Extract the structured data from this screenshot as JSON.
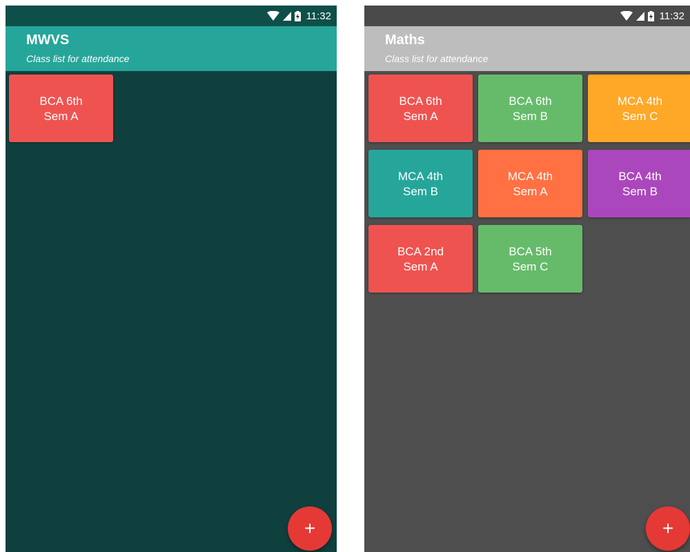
{
  "status": {
    "time": "11:32"
  },
  "screens": [
    {
      "id": "left",
      "title": "MWVS",
      "subtitle": "Class list for attendance",
      "colors": {
        "status_bar": "#0e4f49",
        "app_bar": "#26a69a",
        "background": "#0f403e"
      },
      "classes": [
        {
          "line1": "BCA 6th",
          "line2": "Sem A",
          "color": "#ef5350"
        }
      ],
      "fab": {
        "icon": "plus-icon",
        "label": "+",
        "color": "#e53935"
      }
    },
    {
      "id": "right",
      "title": "Maths",
      "subtitle": "Class list for attendance",
      "colors": {
        "status_bar": "#4a4a4a",
        "app_bar": "#bdbdbd",
        "background": "#4e4e4e"
      },
      "classes": [
        {
          "line1": "BCA 6th",
          "line2": "Sem A",
          "color": "#ef5350"
        },
        {
          "line1": "BCA 6th",
          "line2": "Sem B",
          "color": "#66bb6a"
        },
        {
          "line1": "MCA 4th",
          "line2": "Sem C",
          "color": "#ffa726"
        },
        {
          "line1": "MCA 4th",
          "line2": "Sem B",
          "color": "#26a69a"
        },
        {
          "line1": "MCA 4th",
          "line2": "Sem A",
          "color": "#ff7043"
        },
        {
          "line1": "BCA 4th",
          "line2": "Sem B",
          "color": "#ab47bc"
        },
        {
          "line1": "BCA 2nd",
          "line2": "Sem A",
          "color": "#ef5350"
        },
        {
          "line1": "BCA 5th",
          "line2": "Sem C",
          "color": "#66bb6a"
        }
      ],
      "fab": {
        "icon": "plus-icon",
        "label": "+",
        "color": "#e53935"
      }
    }
  ]
}
